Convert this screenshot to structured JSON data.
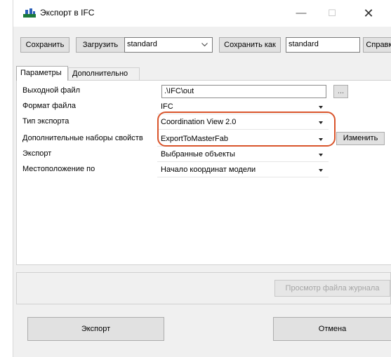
{
  "window": {
    "title": "Экспорт в IFC",
    "minimize_glyph": "—",
    "maximize_glyph": "☐",
    "close_glyph": "✕"
  },
  "toolbar": {
    "save_label": "Сохранить",
    "load_label": "Загрузить",
    "setup_value": "standard",
    "save_as_label": "Сохранить как",
    "save_as_value": "standard",
    "help_label": "Справка"
  },
  "tabs": [
    {
      "label": "Параметры",
      "active": true
    },
    {
      "label": "Дополнительно",
      "active": false
    }
  ],
  "params": {
    "output_file": {
      "label": "Выходной файл",
      "value": ".\\IFC\\out",
      "browse_label": "..."
    },
    "file_format": {
      "label": "Формат файла",
      "value": "IFC"
    },
    "export_type": {
      "label": "Тип экспорта",
      "value": "Coordination View 2.0"
    },
    "property_sets": {
      "label": "Дополнительные наборы свойств",
      "value": "ExportToMasterFab",
      "edit_label": "Изменить"
    },
    "export": {
      "label": "Экспорт",
      "value": "Выбранные объекты"
    },
    "location": {
      "label": "Местоположение по",
      "value": "Начало координат модели"
    }
  },
  "log_button_label": "Просмотр файла журнала",
  "footer": {
    "export_label": "Экспорт",
    "cancel_label": "Отмена"
  },
  "colors": {
    "highlight": "#d9542b",
    "window_bg": "#f0f0f0"
  },
  "icons": {
    "app": "ifc-export-icon",
    "dropdown": "chevron-down-icon"
  }
}
